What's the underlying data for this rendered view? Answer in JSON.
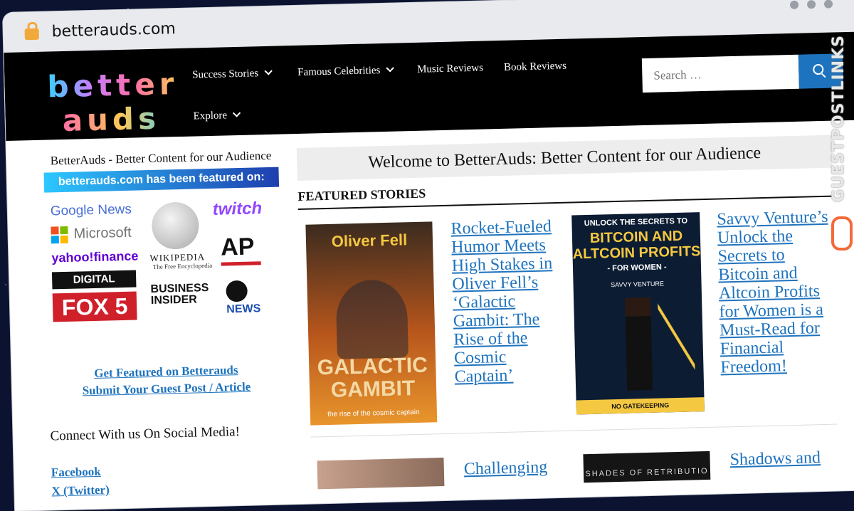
{
  "browser": {
    "url": "betterauds.com"
  },
  "header": {
    "logo_line1": "better",
    "logo_line2": "auds",
    "nav": [
      {
        "label": "Success Stories"
      },
      {
        "label": "Famous Celebrities"
      },
      {
        "label": "Music Reviews"
      },
      {
        "label": "Book Reviews"
      },
      {
        "label": "Explore"
      }
    ],
    "search_placeholder": "Search …"
  },
  "sidebar": {
    "tagline": "BetterAuds - Better Content for our Audience",
    "featured_banner": "betterauds.com has been featured on:",
    "logos": {
      "google_news": "Google News",
      "microsoft": "Microsoft",
      "yahoo_finance": "yahoo!finance",
      "digital_journal": "DIGITAL JOURNAL",
      "fox5": "FOX 5",
      "wikipedia": "WIKIPEDIA",
      "wikipedia_sub": "The Free Encyclopedia",
      "business_insider": "BUSINESS INSIDER",
      "twitch": "twitch",
      "ap": "AP",
      "abc_news": "NEWS"
    },
    "link1": "Get Featured on Betterauds",
    "link2": "Submit Your Guest Post / Article",
    "connect": "Connect With us On Social Media!",
    "social": [
      "Facebook",
      "X (Twitter)"
    ]
  },
  "main": {
    "welcome": "Welcome to BetterAuds: Better Content for our Audience",
    "featured_title": "FEATURED STORIES",
    "stories": [
      {
        "title": "Rocket-Fueled Humor Meets High Stakes in Oliver Fell’s ‘Galactic Gambit: The Rise of the Cosmic Captain’",
        "cover_author": "Oliver Fell",
        "cover_title": "GALACTIC GAMBIT",
        "cover_sub": "the rise of the cosmic captain"
      },
      {
        "title": "Savvy Venture’s Unlock the Secrets to Bitcoin and Altcoin Profits for Women is a Must-Read for Financial Freedom!",
        "cover_top": "UNLOCK THE SECRETS TO",
        "cover_title": "BITCOIN AND ALTCOIN PROFITS",
        "cover_sub": "- FOR WOMEN -",
        "cover_author": "SAVVY VENTURE",
        "cover_footer": "NO GATEKEEPING"
      },
      {
        "title": "Challenging"
      },
      {
        "title": "Shadows and",
        "cover_title": "SHADES OF RETRIBUTIO"
      }
    ]
  },
  "watermark": "GUESTPOSTLINKS",
  "colors": {
    "link": "#1e73be",
    "header_bg": "#000000",
    "search_button": "#1e73be"
  }
}
